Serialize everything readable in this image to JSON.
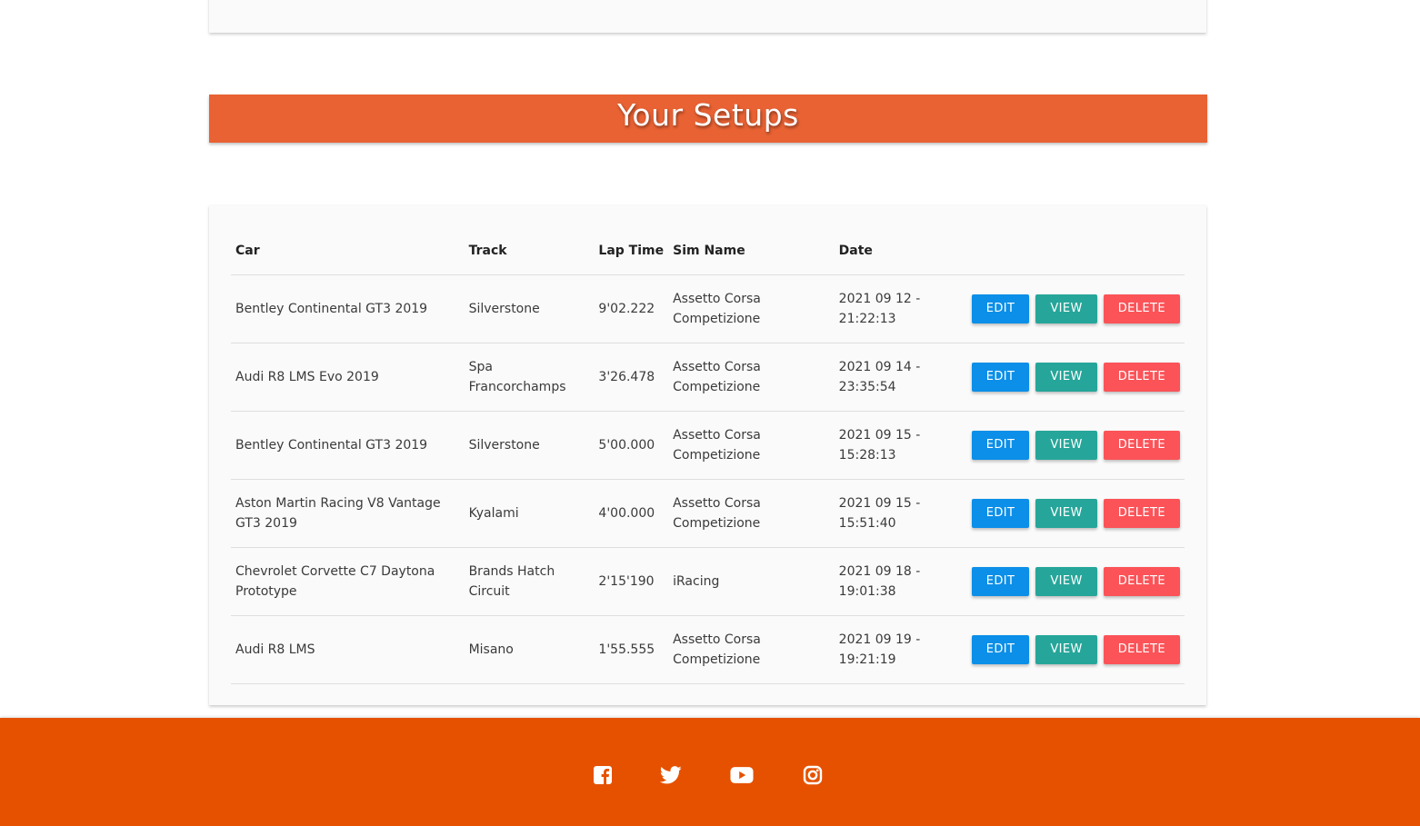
{
  "header": {
    "title": "Your Setups"
  },
  "table": {
    "columns": [
      "Car",
      "Track",
      "Lap Time",
      "Sim Name",
      "Date"
    ],
    "actions": {
      "edit": "EDIT",
      "view": "VIEW",
      "delete": "DELETE"
    },
    "rows": [
      {
        "car": "Bentley Continental GT3 2019",
        "track": "Silverstone",
        "lap_time": "9'02.222",
        "sim": "Assetto Corsa Competizione",
        "date": "2021 09 12 - 21:22:13"
      },
      {
        "car": "Audi R8 LMS Evo 2019",
        "track": "Spa Francorchamps",
        "lap_time": "3'26.478",
        "sim": "Assetto Corsa Competizione",
        "date": "2021 09 14 - 23:35:54"
      },
      {
        "car": "Bentley Continental GT3 2019",
        "track": "Silverstone",
        "lap_time": "5'00.000",
        "sim": "Assetto Corsa Competizione",
        "date": "2021 09 15 - 15:28:13"
      },
      {
        "car": "Aston Martin Racing V8 Vantage GT3 2019",
        "track": "Kyalami",
        "lap_time": "4'00.000",
        "sim": "Assetto Corsa Competizione",
        "date": "2021 09 15 - 15:51:40"
      },
      {
        "car": "Chevrolet Corvette C7 Daytona Prototype",
        "track": "Brands Hatch Circuit",
        "lap_time": "2'15'190",
        "sim": "iRacing",
        "date": "2021 09 18 - 19:01:38"
      },
      {
        "car": "Audi R8 LMS",
        "track": "Misano",
        "lap_time": "1'55.555",
        "sim": "Assetto Corsa Competizione",
        "date": "2021 09 19 - 19:21:19"
      }
    ]
  },
  "footer": {
    "icons": [
      "facebook-icon",
      "twitter-icon",
      "youtube-icon",
      "instagram-icon"
    ]
  },
  "colors": {
    "banner": "#e96233",
    "footer": "#e65100",
    "edit": "#0b8fe8",
    "view": "#26a69a",
    "delete": "#fb5358"
  }
}
